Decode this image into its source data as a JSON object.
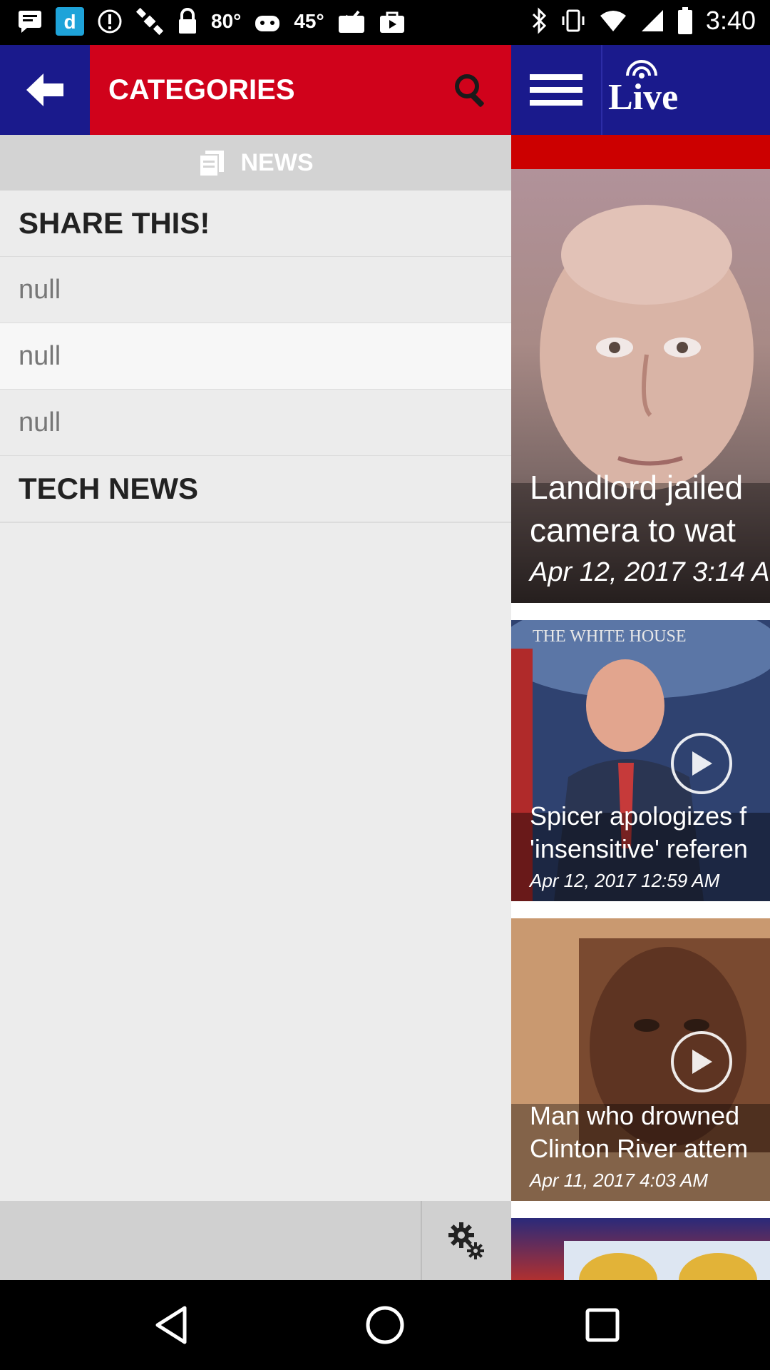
{
  "status_bar": {
    "time": "3:40",
    "temp1": "80°",
    "temp2": "45°",
    "icons": [
      "message-icon",
      "app-icon",
      "alert-icon",
      "satellite-icon",
      "lock-icon",
      "weather-icon",
      "android-icon",
      "inbox-icon",
      "shop-icon",
      "bluetooth-icon",
      "vibrate-icon",
      "wifi-icon",
      "signal-icon",
      "battery-icon"
    ]
  },
  "drawer": {
    "title": "CATEGORIES",
    "section": "NEWS",
    "items": [
      {
        "label": "SHARE THIS!"
      },
      {
        "label": "null"
      },
      {
        "label": "null"
      },
      {
        "label": "null"
      },
      {
        "label": "TECH NEWS"
      }
    ]
  },
  "feed": {
    "live_label": "Live",
    "articles": [
      {
        "headline": "Landlord jailed camera to wat",
        "date": "Apr 12, 2017 3:14 A"
      },
      {
        "headline": "Spicer apologizes f 'insensitive' referen",
        "date": "Apr 12, 2017 12:59 AM"
      },
      {
        "headline": "Man who drowned Clinton River attem",
        "date": "Apr 11, 2017 4:03 AM"
      }
    ]
  },
  "colors": {
    "primary_blue": "#1a1a8c",
    "brand_red": "#d0021b",
    "drawer_bg": "#ececec"
  }
}
